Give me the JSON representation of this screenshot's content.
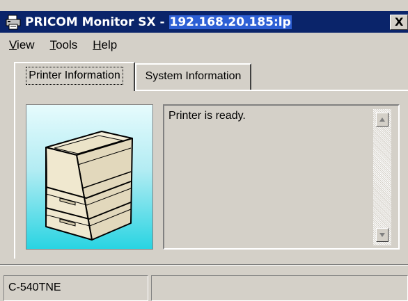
{
  "window": {
    "title_prefix": "PRICOM Monitor SX - ",
    "title_host": "192.168.20.185:lp",
    "close_glyph": "X"
  },
  "menu": [
    {
      "accel": "V",
      "rest": "iew"
    },
    {
      "accel": "T",
      "rest": "ools"
    },
    {
      "accel": "H",
      "rest": "elp"
    }
  ],
  "tabs": [
    {
      "label": "Printer Information",
      "active": true
    },
    {
      "label": "System Information",
      "active": false
    }
  ],
  "printer": {
    "icon": "printer-icon",
    "status_message": "Printer is ready."
  },
  "statusbar": {
    "model": "C-540TNE",
    "info": ""
  },
  "colors": {
    "titlebar": "#0a246a",
    "title_highlight": "#2d5fd5",
    "face": "#d4d0c8",
    "image_background_top": "#e6fbfd",
    "image_background_bottom": "#29d4e2"
  }
}
